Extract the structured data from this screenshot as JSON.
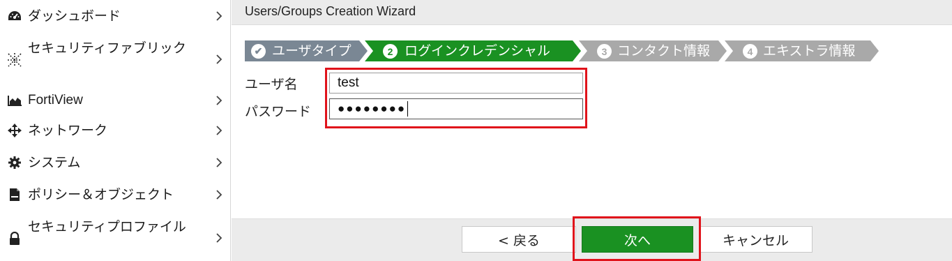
{
  "sidebar": {
    "items": [
      {
        "label": "ダッシュボード",
        "icon": "dashboard-icon"
      },
      {
        "label": "セキュリティファブリック",
        "icon": "security-fabric-icon"
      },
      {
        "label": "FortiView",
        "icon": "area-chart-icon"
      },
      {
        "label": "ネットワーク",
        "icon": "network-move-icon"
      },
      {
        "label": "システム",
        "icon": "gear-icon"
      },
      {
        "label": "ポリシー＆オブジェクト",
        "icon": "policy-document-icon"
      },
      {
        "label": "セキュリティプロファイル",
        "icon": "lock-icon"
      }
    ]
  },
  "wizard": {
    "title": "Users/Groups Creation Wizard",
    "steps": [
      {
        "number": "✔",
        "label": "ユーザタイプ",
        "state": "done",
        "color": "#7a8794"
      },
      {
        "number": "2",
        "label": "ログインクレデンシャル",
        "state": "active",
        "color": "#1a9122"
      },
      {
        "number": "3",
        "label": "コンタクト情報",
        "state": "pending",
        "color": "#a9a9a9"
      },
      {
        "number": "4",
        "label": "エキストラ情報",
        "state": "pending",
        "color": "#a9a9a9"
      }
    ],
    "fields": {
      "username_label": "ユーザ名",
      "username_value": "test",
      "password_label": "パスワード",
      "password_value": "●●●●●●●●"
    },
    "buttons": {
      "back": "< 戻る",
      "next": "次へ",
      "cancel": "キャンセル"
    }
  },
  "colors": {
    "accent": "#1a9122",
    "highlight": "#e0131b",
    "done_step": "#7a8794",
    "pending_step": "#a9a9a9"
  }
}
